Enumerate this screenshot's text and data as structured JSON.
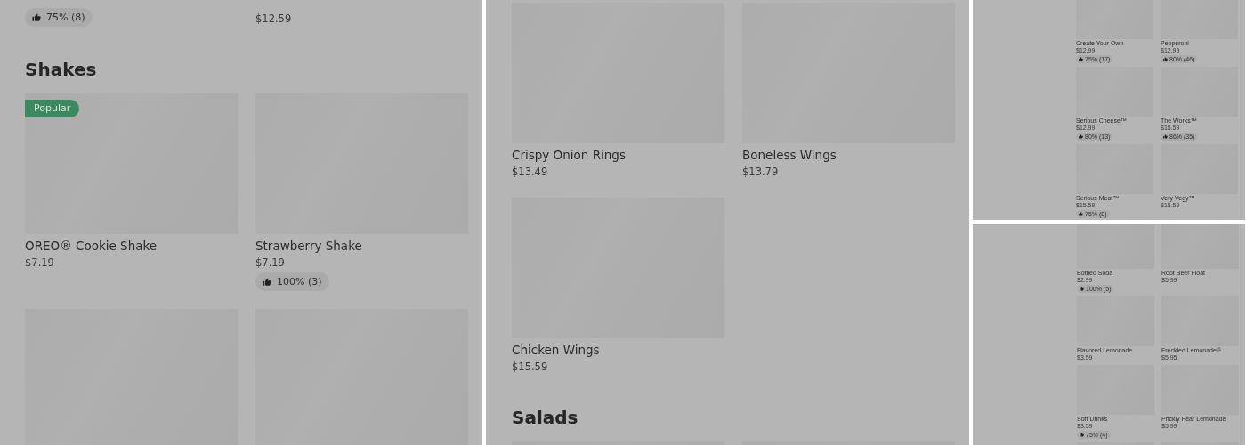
{
  "panels": [
    {
      "kind": "full",
      "blocks": [
        {
          "kind": "cards",
          "cards": [
            {
              "kind": "text-only",
              "rating": "75% (8)"
            },
            {
              "kind": "text-only",
              "price": "$12.59"
            }
          ]
        },
        {
          "kind": "heading",
          "text": "Shakes"
        },
        {
          "kind": "cards",
          "cards": [
            {
              "kind": "item",
              "badge": "Popular",
              "name": "OREO® Cookie Shake",
              "price": "$7.19"
            },
            {
              "kind": "item",
              "name": "Strawberry Shake",
              "price": "$7.19",
              "rating": "100% (3)"
            }
          ]
        },
        {
          "kind": "cards",
          "cards": [
            {
              "kind": "image-only"
            },
            {
              "kind": "image-only"
            }
          ]
        }
      ]
    },
    {
      "kind": "full",
      "blocks": [
        {
          "kind": "cards",
          "cards": [
            {
              "kind": "item",
              "name": "Crispy Onion Rings",
              "price": "$13.49"
            },
            {
              "kind": "item",
              "name": "Boneless Wings",
              "price": "$13.79"
            }
          ]
        },
        {
          "kind": "cards",
          "cards": [
            {
              "kind": "item",
              "name": "Chicken Wings",
              "price": "$15.59"
            }
          ]
        },
        {
          "kind": "heading",
          "text": "Salads"
        },
        {
          "kind": "cards",
          "cards": [
            {
              "kind": "image-only"
            },
            {
              "kind": "image-only"
            }
          ]
        }
      ]
    },
    {
      "kind": "thumbnail",
      "blocks": [
        {
          "kind": "cards",
          "cards": [
            {
              "kind": "item",
              "name": "Create Your Own",
              "price": "$12.99",
              "rating": "75% (17)"
            },
            {
              "kind": "item",
              "name": "Pepperoni",
              "price": "$12.99",
              "rating": "80% (46)"
            }
          ]
        },
        {
          "kind": "cards",
          "cards": [
            {
              "kind": "item",
              "name": "Serious Cheese™",
              "price": "$12.99",
              "rating": "80% (13)"
            },
            {
              "kind": "item",
              "name": "The Works™",
              "price": "$15.59",
              "rating": "86% (35)"
            }
          ]
        },
        {
          "kind": "cards",
          "cards": [
            {
              "kind": "item",
              "name": "Serious Meat™",
              "price": "$15.59",
              "rating": "75% (8)"
            },
            {
              "kind": "item",
              "name": "Very Vegy™",
              "price": "$15.59"
            }
          ]
        }
      ]
    },
    {
      "kind": "thumbnail",
      "blocks": [
        {
          "kind": "cards",
          "cards": [
            {
              "kind": "item",
              "name": "Bottled Soda",
              "price": "$2.99",
              "rating": "100% (5)"
            },
            {
              "kind": "item",
              "name": "Root Beer Float",
              "price": "$5.99"
            }
          ]
        },
        {
          "kind": "cards",
          "cards": [
            {
              "kind": "item",
              "name": "Flavored Lemonade",
              "price": "$3.59"
            },
            {
              "kind": "item",
              "name": "Freckled Lemonade®",
              "price": "$5.95"
            }
          ]
        },
        {
          "kind": "cards",
          "cards": [
            {
              "kind": "item",
              "name": "Soft Drinks",
              "price": "$3.59",
              "rating": "75% (4)"
            },
            {
              "kind": "item",
              "name": "Prickly Pear Lemonade",
              "price": "$5.99"
            }
          ]
        },
        {
          "kind": "cards",
          "cards": [
            {
              "kind": "image-only"
            },
            {
              "kind": "image-only"
            }
          ]
        }
      ]
    }
  ]
}
